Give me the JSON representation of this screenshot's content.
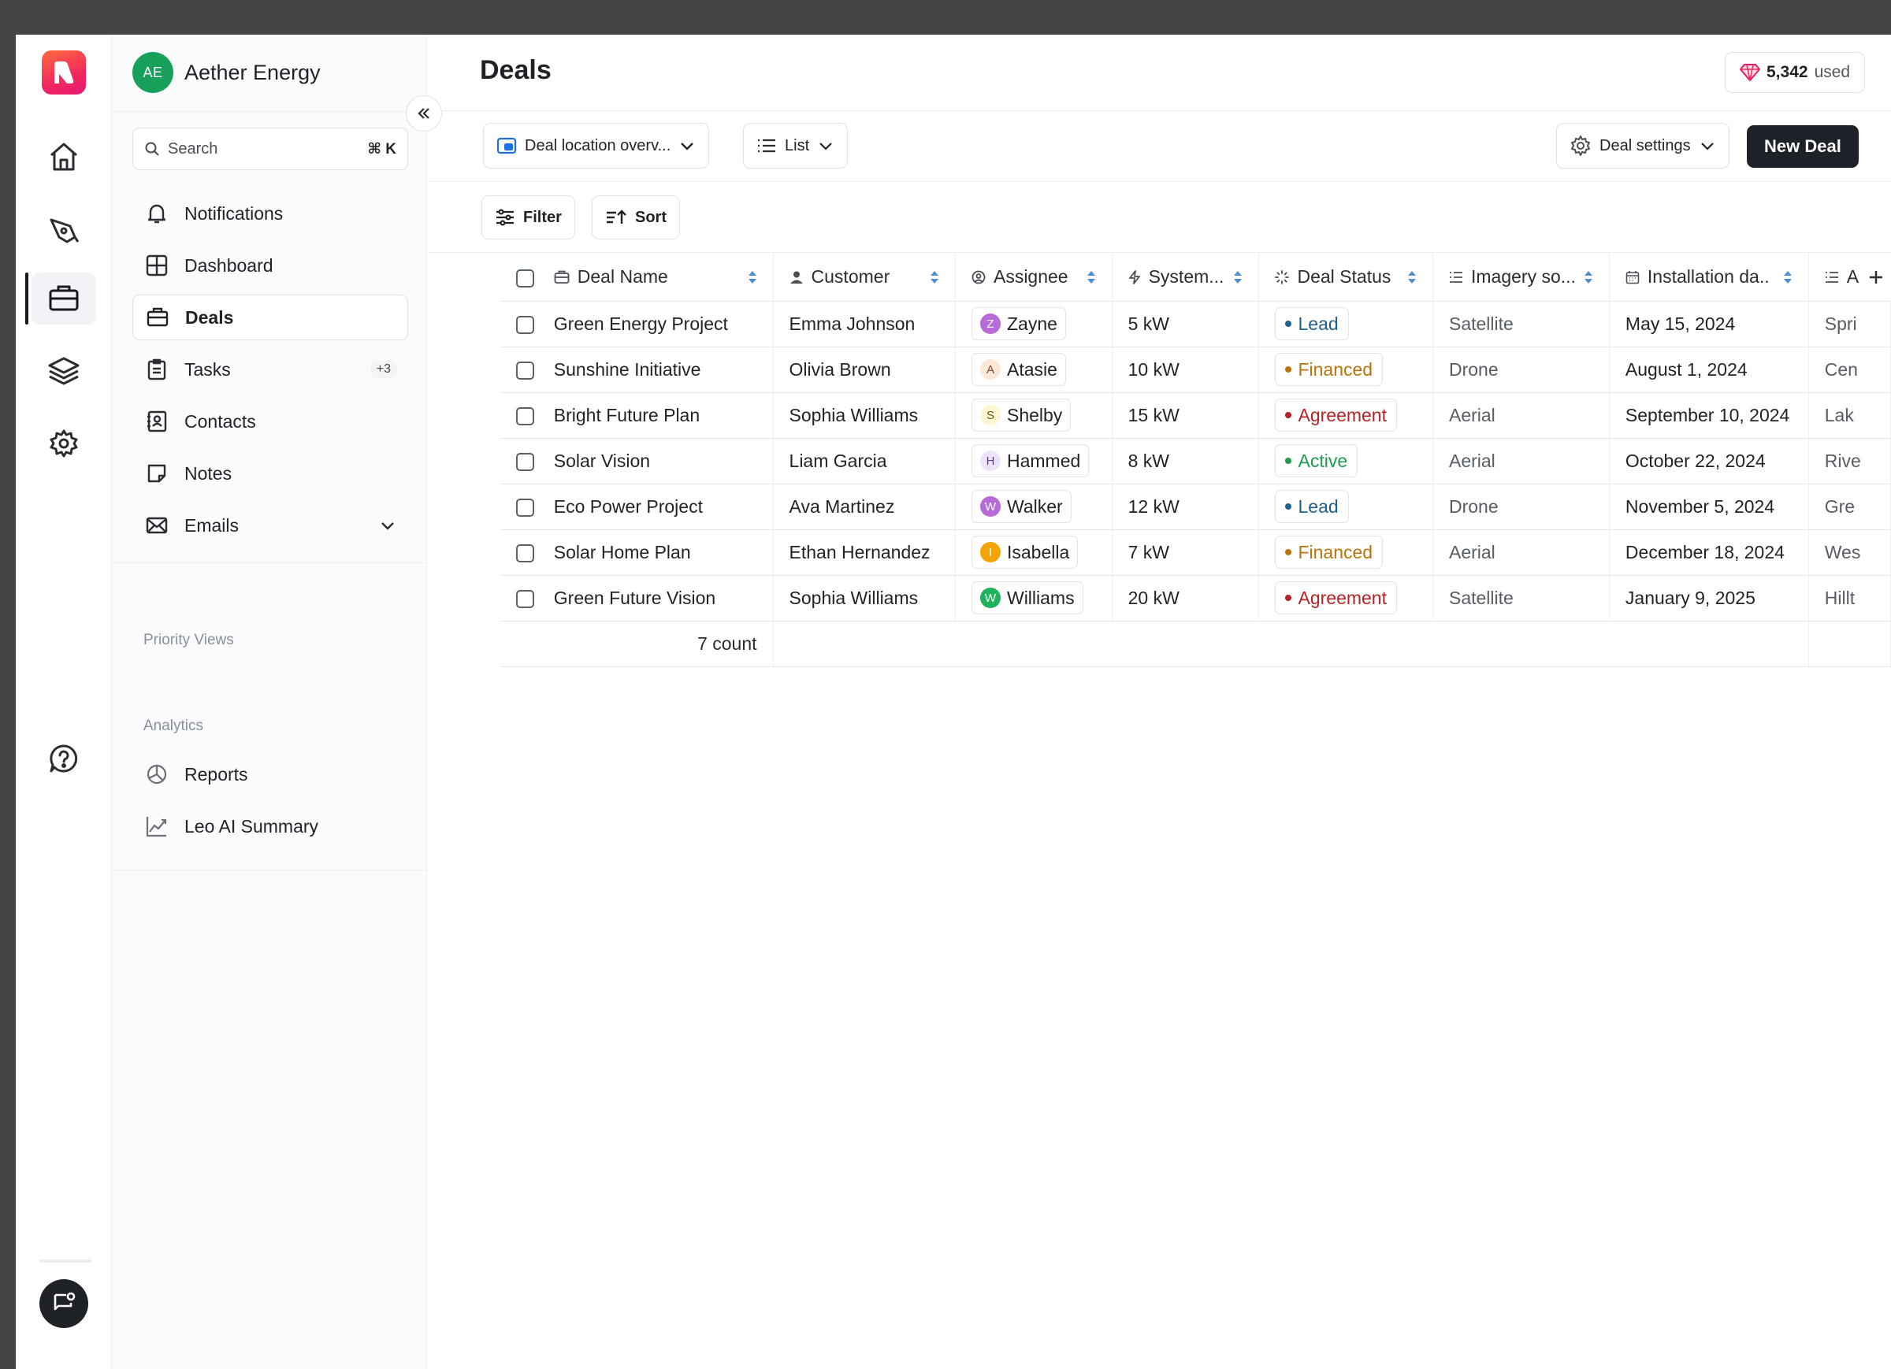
{
  "rail": {
    "items": [
      "home",
      "design",
      "deals",
      "layers",
      "settings",
      "help"
    ]
  },
  "workspace": {
    "initials": "AE",
    "name": "Aether Energy"
  },
  "search": {
    "placeholder": "Search",
    "shortcut": "⌘ K"
  },
  "nav": {
    "notifications": "Notifications",
    "dashboard": "Dashboard",
    "deals": "Deals",
    "tasks": "Tasks",
    "tasks_badge": "+3",
    "contacts": "Contacts",
    "notes": "Notes",
    "emails": "Emails"
  },
  "sections": {
    "priority_views": "Priority Views",
    "analytics": "Analytics",
    "reports": "Reports",
    "leo": "Leo AI Summary"
  },
  "page": {
    "title": "Deals",
    "credits_value": "5,342",
    "credits_label": "used"
  },
  "toolbar": {
    "view_select": "Deal location overv...",
    "layout_select": "List",
    "settings": "Deal settings",
    "new_deal": "New Deal",
    "filter": "Filter",
    "sort": "Sort"
  },
  "table": {
    "columns": [
      "Deal Name",
      "Customer",
      "Assignee",
      "System...",
      "Deal Status",
      "Imagery so...",
      "Installation da..",
      "A"
    ],
    "rows": [
      {
        "deal": "Green Energy Project",
        "customer": "Emma Johnson",
        "assignee": "Zayne",
        "initial": "Z",
        "system": "5 kW",
        "status": "Lead",
        "imagery": "Satellite",
        "install": "May 15, 2024",
        "address": "Spri"
      },
      {
        "deal": "Sunshine Initiative",
        "customer": "Olivia Brown",
        "assignee": "Atasie",
        "initial": "A",
        "system": "10 kW",
        "status": "Financed",
        "imagery": "Drone",
        "install": "August 1, 2024",
        "address": "Cen"
      },
      {
        "deal": "Bright Future Plan",
        "customer": "Sophia Williams",
        "assignee": "Shelby",
        "initial": "S",
        "system": "15 kW",
        "status": "Agreement",
        "imagery": "Aerial",
        "install": "September 10, 2024",
        "address": "Lak"
      },
      {
        "deal": "Solar Vision",
        "customer": "Liam Garcia",
        "assignee": "Hammed",
        "initial": "H",
        "system": "8 kW",
        "status": "Active",
        "imagery": "Aerial",
        "install": "October 22, 2024",
        "address": "Rive"
      },
      {
        "deal": "Eco Power Project",
        "customer": "Ava Martinez",
        "assignee": "Walker",
        "initial": "W",
        "system": "12 kW",
        "status": "Lead",
        "imagery": "Drone",
        "install": "November 5, 2024",
        "address": "Gre"
      },
      {
        "deal": "Solar Home Plan",
        "customer": "Ethan Hernandez",
        "assignee": "Isabella",
        "initial": "I",
        "system": "7 kW",
        "status": "Financed",
        "imagery": "Aerial",
        "install": "December 18, 2024",
        "address": "Wes"
      },
      {
        "deal": "Green Future Vision",
        "customer": "Sophia Williams",
        "assignee": "Williams",
        "initial": "W",
        "system": "20 kW",
        "status": "Agreement",
        "imagery": "Satellite",
        "install": "January 9, 2025",
        "address": "Hillt"
      }
    ],
    "footer_count": "7 count"
  },
  "colors": {
    "avatar_bg": [
      "#b66bd6",
      "#fde7d6",
      "#fdf6d2",
      "#efe3fb",
      "#b66bd6",
      "#f5a300",
      "#1fb35c"
    ],
    "avatar_fg": [
      "#ffffff",
      "#7a4a2a",
      "#6b5a10",
      "#5b3c85",
      "#ffffff",
      "#ffffff",
      "#ffffff"
    ],
    "status": {
      "Lead": {
        "text": "#1f5f8b",
        "dot": "#1f5f8b"
      },
      "Financed": {
        "text": "#b8740a",
        "dot": "#b8740a"
      },
      "Agreement": {
        "text": "#b42323",
        "dot": "#b42323"
      },
      "Active": {
        "text": "#1f9a4f",
        "dot": "#1f9a4f"
      }
    }
  }
}
